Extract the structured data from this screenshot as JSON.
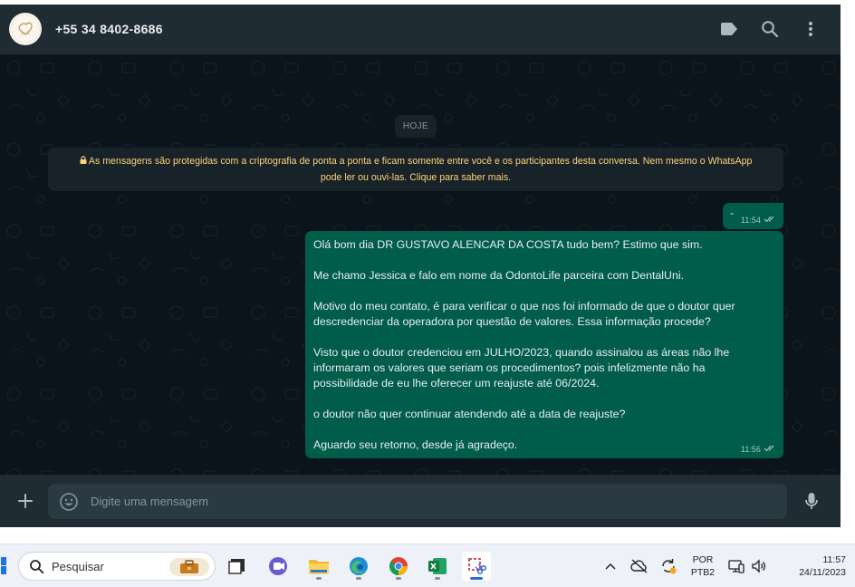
{
  "header": {
    "contact": "+55 34 8402-8686",
    "icons": [
      "label-icon",
      "search-icon",
      "menu-icon"
    ]
  },
  "chat": {
    "date_chip": "HOJE",
    "encryption_notice": [
      "As mensagens são protegidas com a criptografia de ponta a ponta e ficam somente entre você e os participantes desta conversa. Nem mesmo o WhatsApp",
      "pode ler ou ouvi-las. Clique para saber mais."
    ],
    "messages": [
      {
        "text": "-",
        "time": "11:54",
        "status": "read"
      },
      {
        "lines": [
          "Olá bom dia DR GUSTAVO ALENCAR DA COSTA tudo bem? Estimo que sim.",
          "",
          "Me chamo Jessica e falo em nome da OdontoLife parceira com DentalUni.",
          "",
          "Motivo do meu contato, é para verificar o que nos foi informado de que o doutor quer",
          "descredenciar da operadora por questão de valores. Essa informação procede?",
          "",
          "Visto que o doutor credenciou em JULHO/2023, quando assinalou as áreas não lhe",
          "informaram os valores que seriam os procedimentos? pois infelizmente não ha",
          "possibilidade de eu lhe oferecer um reajuste até 06/2024.",
          "",
          "o doutor não quer continuar atendendo até a data de reajuste?",
          "",
          "Aguardo seu retorno, desde já agradeço."
        ],
        "time": "11:56",
        "status": "read"
      }
    ]
  },
  "composer": {
    "placeholder": "Digite uma mensagem"
  },
  "taskbar": {
    "search_placeholder": "Pesquisar",
    "apps": [
      "task-view",
      "teams",
      "file-explorer",
      "edge",
      "chrome",
      "excel",
      "snipping-tool"
    ],
    "lang_line1": "POR",
    "lang_line2": "PTB2",
    "time": "11:57",
    "date": "24/11/2023"
  },
  "colors": {
    "header": "#202c33",
    "chat_bg": "#0b141a",
    "outgoing_bubble": "#005c4b",
    "notice_text": "#ffd279",
    "tick": "#a9c7c0"
  }
}
